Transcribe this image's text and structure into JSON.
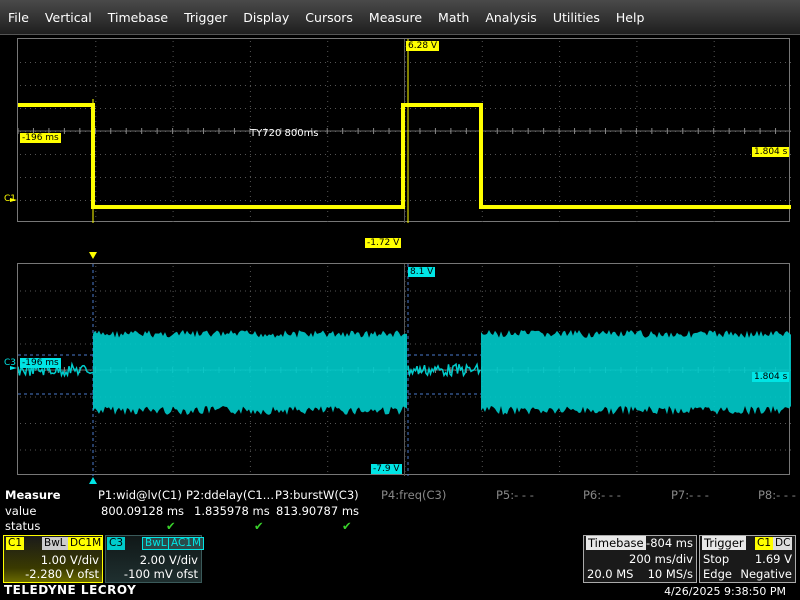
{
  "menu": [
    "File",
    "Vertical",
    "Timebase",
    "Trigger",
    "Display",
    "Cursors",
    "Measure",
    "Math",
    "Analysis",
    "Utilities",
    "Help"
  ],
  "grid1": {
    "top_level_label": "6.28 V",
    "bottom_level_label": "-1.72 V",
    "left_time_label": "-196 ms",
    "right_time_label": "1.804 s",
    "channel_marker": "C1",
    "annotation": "TY720 800ms",
    "trace_color": "#ffff00"
  },
  "grid2": {
    "top_level_label": "8.1 V",
    "bottom_level_label": "-7.9 V",
    "left_time_label": "-196 ms",
    "right_time_label": "1.804 s",
    "channel_marker": "C3",
    "trace_color": "#00cccc"
  },
  "measure": {
    "header": "Measure",
    "row_value_label": "value",
    "row_status_label": "status",
    "params": [
      {
        "name": "P1:wid@lv(C1)",
        "value": "800.09128 ms",
        "ok": true
      },
      {
        "name": "P2:ddelay(C1…",
        "value": "1.835978 ms",
        "ok": true
      },
      {
        "name": "P3:burstW(C3)",
        "value": "813.90787 ms",
        "ok": true
      },
      {
        "name": "P4:freq(C3)",
        "value": "",
        "ok": false
      },
      {
        "name": "P5:- - -",
        "value": "",
        "ok": false
      },
      {
        "name": "P6:- - -",
        "value": "",
        "ok": false
      },
      {
        "name": "P7:- - -",
        "value": "",
        "ok": false
      },
      {
        "name": "P8:- - -",
        "value": "",
        "ok": false
      }
    ],
    "check_glyph": "✔"
  },
  "c1": {
    "label": "C1",
    "bw": "BwL",
    "coupling": "DC1M",
    "vdiv": "1.00 V/div",
    "offset": "-2.280 V ofst"
  },
  "c3": {
    "label": "C3",
    "bw": "BwL",
    "coupling": "AC1M",
    "vdiv": "2.00 V/div",
    "offset": "-100 mV ofst"
  },
  "timebase": {
    "label": "Timebase",
    "delay": "-804 ms",
    "tdiv": "200 ms/div",
    "samples": "20.0 MS",
    "rate": "10 MS/s"
  },
  "trigger": {
    "label": "Trigger",
    "source": "C1",
    "coupling": "DC",
    "mode": "Stop",
    "level": "1.69 V",
    "type": "Edge",
    "slope": "Negative"
  },
  "brand": "TELEDYNE LECROY",
  "datetime": "4/26/2025 9:38:50 PM"
}
